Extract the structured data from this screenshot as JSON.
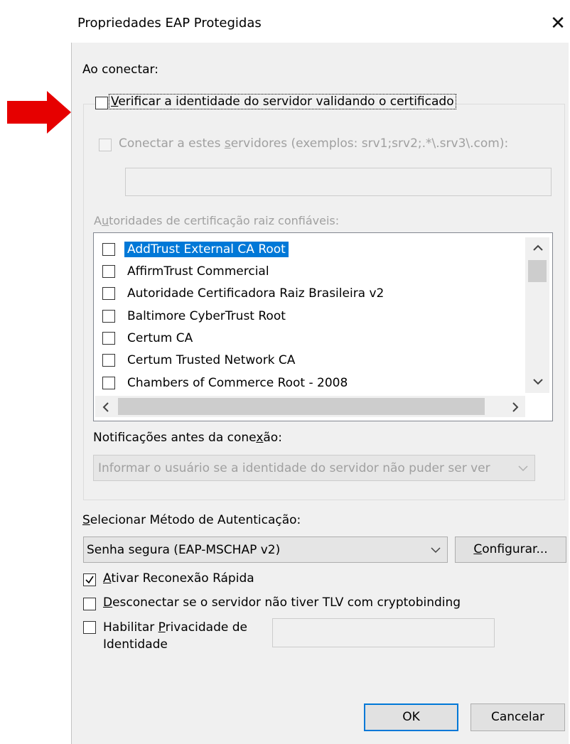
{
  "dialog": {
    "title": "Propriedades EAP Protegidas",
    "close_symbol": "✕"
  },
  "connect": {
    "section_label": "Ao conectar:",
    "verify_pre": "",
    "verify_u": "V",
    "verify_post": "erificar a identidade do servidor validando o certificado",
    "verify_checked": false,
    "servers_pre": "Conectar a estes ",
    "servers_u": "s",
    "servers_post": "ervidores (exemplos: srv1;srv2;.*\\.srv3\\.com):",
    "servers_value": "",
    "trusted_ca_pre": "A",
    "trusted_ca_u": "u",
    "trusted_ca_post": "toridades de certificação raiz confiáveis:"
  },
  "certificates": [
    {
      "name": "AddTrust External CA Root",
      "checked": false,
      "selected": true
    },
    {
      "name": "AffirmTrust Commercial",
      "checked": false,
      "selected": false
    },
    {
      "name": "Autoridade Certificadora Raiz Brasileira v2",
      "checked": false,
      "selected": false
    },
    {
      "name": "Baltimore CyberTrust Root",
      "checked": false,
      "selected": false
    },
    {
      "name": "Certum CA",
      "checked": false,
      "selected": false
    },
    {
      "name": "Certum Trusted Network CA",
      "checked": false,
      "selected": false
    },
    {
      "name": "Chambers of Commerce Root - 2008",
      "checked": false,
      "selected": false
    }
  ],
  "notifications": {
    "label_pre": "Notificações antes da cone",
    "label_u": "x",
    "label_post": "ão:",
    "value": "Informar o usuário se a identidade do servidor não puder ser ver"
  },
  "auth": {
    "label_pre": "",
    "label_u": "S",
    "label_post": "elecionar Método de Autenticação:",
    "method": "Senha segura (EAP-MSCHAP v2)",
    "configure_u": "C",
    "configure_post": "onfigurar..."
  },
  "options": {
    "fast_reconnect_u": "A",
    "fast_reconnect_post": "tivar Reconexão Rápida",
    "fast_reconnect_checked": true,
    "disconnect_u": "D",
    "disconnect_post": "esconectar se o servidor não tiver TLV com cryptobinding",
    "disconnect_checked": false,
    "privacy_pre": "Habilitar ",
    "privacy_u": "P",
    "privacy_post": "rivacidade de",
    "privacy_line2": "Identidade",
    "privacy_checked": false,
    "privacy_value": ""
  },
  "buttons": {
    "ok": "OK",
    "cancel": "Cancelar"
  },
  "colors": {
    "selection": "#0078d7",
    "arrow": "#e60000",
    "dialog_bg": "#f0f0f0"
  },
  "icons": {
    "arrow": "red-arrow-right-icon",
    "close": "close-icon",
    "check": "checkmark-icon",
    "scroll_up": "chevron-up-icon",
    "scroll_down": "chevron-down-icon",
    "scroll_left": "chevron-left-icon",
    "scroll_right": "chevron-right-icon",
    "combo_arrow": "chevron-down-icon"
  }
}
